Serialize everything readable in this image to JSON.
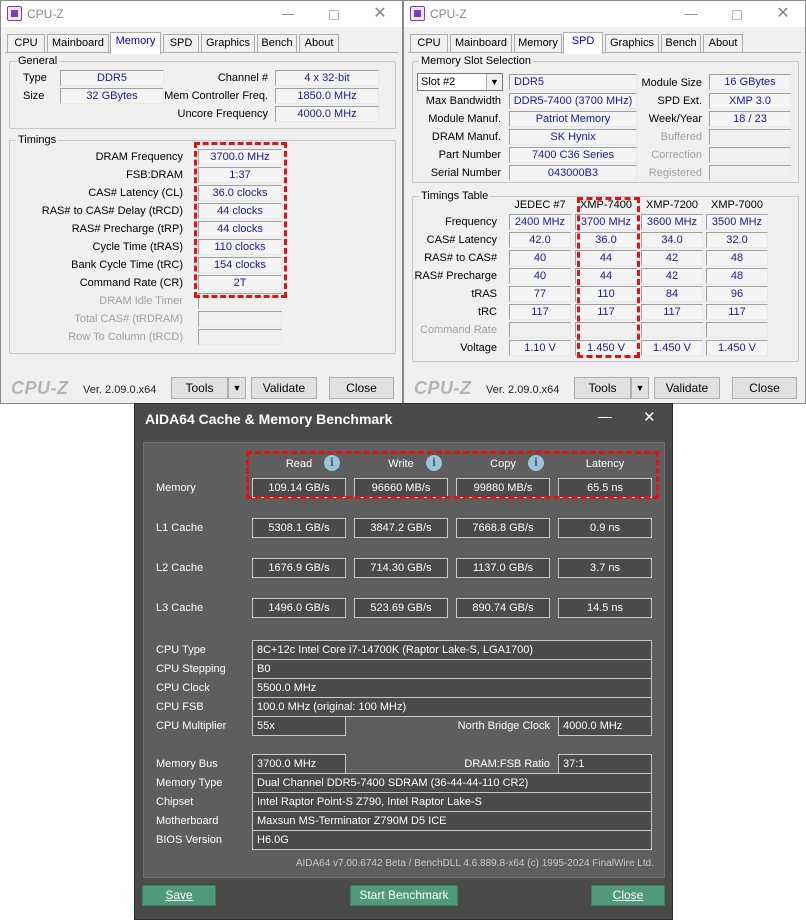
{
  "left": {
    "title": "CPU-Z",
    "tabs": [
      "CPU",
      "Mainboard",
      "Memory",
      "SPD",
      "Graphics",
      "Bench",
      "About"
    ],
    "general": {
      "title": "General",
      "type_label": "Type",
      "type": "DDR5",
      "size_label": "Size",
      "size": "32 GBytes",
      "channel_label": "Channel #",
      "channel": "4 x 32-bit",
      "mcf_label": "Mem Controller Freq.",
      "mcf": "1850.0 MHz",
      "uncore_label": "Uncore Frequency",
      "uncore": "4000.0 MHz"
    },
    "timings": {
      "title": "Timings",
      "rows": [
        {
          "label": "DRAM Frequency",
          "value": "3700.0 MHz"
        },
        {
          "label": "FSB:DRAM",
          "value": "1:37"
        },
        {
          "label": "CAS# Latency (CL)",
          "value": "36.0 clocks"
        },
        {
          "label": "RAS# to CAS# Delay (tRCD)",
          "value": "44 clocks"
        },
        {
          "label": "RAS# Precharge (tRP)",
          "value": "44 clocks"
        },
        {
          "label": "Cycle Time (tRAS)",
          "value": "110 clocks"
        },
        {
          "label": "Bank Cycle Time (tRC)",
          "value": "154 clocks"
        },
        {
          "label": "Command Rate (CR)",
          "value": "2T"
        }
      ],
      "disabled": [
        "DRAM Idle Timer",
        "Total CAS# (tRDRAM)",
        "Row To Column (tRCD)"
      ]
    },
    "brand": "CPU-Z",
    "version": "Ver. 2.09.0.x64",
    "tools": "Tools",
    "validate": "Validate",
    "close": "Close"
  },
  "right": {
    "title": "CPU-Z",
    "tabs": [
      "CPU",
      "Mainboard",
      "Memory",
      "SPD",
      "Graphics",
      "Bench",
      "About"
    ],
    "slot": {
      "title": "Memory Slot Selection",
      "selected": "Slot #2",
      "type": "DDR5",
      "module_size_label": "Module Size",
      "module_size": "16 GBytes",
      "max_bw_label": "Max Bandwidth",
      "max_bw": "DDR5-7400 (3700 MHz)",
      "spd_ext_label": "SPD Ext.",
      "spd_ext": "XMP 3.0",
      "manuf_label": "Module Manuf.",
      "manuf": "Patriot Memory",
      "week_label": "Week/Year",
      "week": "18 / 23",
      "dram_manuf_label": "DRAM Manuf.",
      "dram_manuf": "SK Hynix",
      "buffered_label": "Buffered",
      "part_label": "Part Number",
      "part": "7400 C36 Series",
      "correction_label": "Correction",
      "serial_label": "Serial Number",
      "serial": "043000B3",
      "registered_label": "Registered"
    },
    "table": {
      "title": "Timings Table",
      "columns": [
        "JEDEC #7",
        "XMP-7400",
        "XMP-7200",
        "XMP-7000"
      ],
      "rows": [
        {
          "label": "Frequency",
          "values": [
            "2400 MHz",
            "3700 MHz",
            "3600 MHz",
            "3500 MHz"
          ]
        },
        {
          "label": "CAS# Latency",
          "values": [
            "42.0",
            "36.0",
            "34.0",
            "32.0"
          ]
        },
        {
          "label": "RAS# to CAS#",
          "values": [
            "40",
            "44",
            "42",
            "48"
          ]
        },
        {
          "label": "RAS# Precharge",
          "values": [
            "40",
            "44",
            "42",
            "48"
          ]
        },
        {
          "label": "tRAS",
          "values": [
            "77",
            "110",
            "84",
            "96"
          ]
        },
        {
          "label": "tRC",
          "values": [
            "117",
            "117",
            "117",
            "117"
          ]
        },
        {
          "label": "Command Rate",
          "values": [
            "",
            "",
            "",
            ""
          ]
        },
        {
          "label": "Voltage",
          "values": [
            "1.10 V",
            "1.450 V",
            "1.450 V",
            "1.450 V"
          ]
        }
      ]
    },
    "brand": "CPU-Z",
    "version": "Ver. 2.09.0.x64",
    "tools": "Tools",
    "validate": "Validate",
    "close": "Close"
  },
  "aida": {
    "title": "AIDA64 Cache & Memory Benchmark",
    "headers": [
      "Read",
      "Write",
      "Copy",
      "Latency"
    ],
    "bench": [
      {
        "label": "Memory",
        "values": [
          "109.14 GB/s",
          "96660 MB/s",
          "99880 MB/s",
          "65.5 ns"
        ]
      },
      {
        "label": "L1 Cache",
        "values": [
          "5308.1 GB/s",
          "3847.2 GB/s",
          "7668.8 GB/s",
          "0.9 ns"
        ]
      },
      {
        "label": "L2 Cache",
        "values": [
          "1676.9 GB/s",
          "714.30 GB/s",
          "1137.0 GB/s",
          "3.7 ns"
        ]
      },
      {
        "label": "L3 Cache",
        "values": [
          "1496.0 GB/s",
          "523.69 GB/s",
          "890.74 GB/s",
          "14.5 ns"
        ]
      }
    ],
    "cpu_type_label": "CPU Type",
    "cpu_type": "8C+12c Intel Core i7-14700K  (Raptor Lake-S, LGA1700)",
    "cpu_stepping_label": "CPU Stepping",
    "cpu_stepping": "B0",
    "cpu_clock_label": "CPU Clock",
    "cpu_clock": "5500.0 MHz",
    "cpu_fsb_label": "CPU FSB",
    "cpu_fsb": "100.0 MHz  (original: 100 MHz)",
    "cpu_mult_label": "CPU Multiplier",
    "cpu_mult": "55x",
    "nb_clock_label": "North Bridge Clock",
    "nb_clock": "4000.0 MHz",
    "mem_bus_label": "Memory Bus",
    "mem_bus": "3700.0 MHz",
    "ratio_label": "DRAM:FSB Ratio",
    "ratio": "37:1",
    "mem_type_label": "Memory Type",
    "mem_type": "Dual Channel DDR5-7400 SDRAM  (36-44-44-110 CR2)",
    "chipset_label": "Chipset",
    "chipset": "Intel Raptor Point-S Z790, Intel Raptor Lake-S",
    "mobo_label": "Motherboard",
    "mobo": "Maxsun MS-Terminator Z790M D5 ICE",
    "bios_label": "BIOS Version",
    "bios": "H6.0G",
    "footer": "AIDA64 v7.00.6742 Beta / BenchDLL 4.6.889.8-x64  (c) 1995-2024 FinalWire Ltd.",
    "save": "Save",
    "start": "Start Benchmark",
    "close": "Close"
  }
}
